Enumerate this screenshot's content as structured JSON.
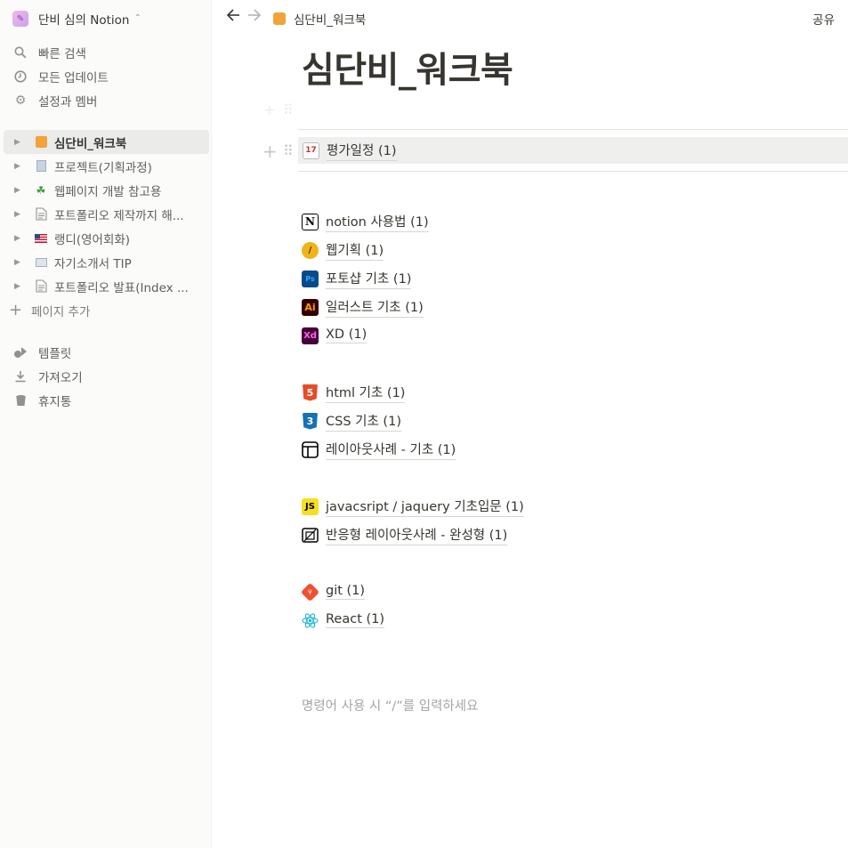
{
  "workspace": {
    "name": "단비 심의 Notion"
  },
  "sidebar": {
    "menu": [
      {
        "label": "빠른 검색",
        "icon": "search-icon"
      },
      {
        "label": "모든 업데이트",
        "icon": "clock-icon"
      },
      {
        "label": "설정과 멤버",
        "icon": "gear-icon"
      }
    ],
    "pages": [
      {
        "label": "심단비_워크북",
        "icon": "book-icon",
        "active": true
      },
      {
        "label": "프로젝트(기획과정)",
        "icon": "doc-icon"
      },
      {
        "label": "웹페이지 개발 참고용",
        "icon": "shamrock-icon"
      },
      {
        "label": "포트폴리오 제작까지 해...",
        "icon": "page-icon"
      },
      {
        "label": "랭디(영어회화)",
        "icon": "us-flag-icon"
      },
      {
        "label": "자기소개서 TIP",
        "icon": "computer-icon"
      },
      {
        "label": "포트폴리오 발표(Index ...",
        "icon": "page-icon"
      }
    ],
    "add_page": "페이지 추가",
    "bottom": [
      {
        "label": "템플릿",
        "icon": "shapes-icon"
      },
      {
        "label": "가져오기",
        "icon": "download-icon"
      },
      {
        "label": "휴지통",
        "icon": "trash-icon"
      }
    ]
  },
  "topbar": {
    "breadcrumb": "심단비_워크북",
    "share": "공유"
  },
  "page": {
    "title": "심단비_워크북",
    "eval_link": "평가일정 (1)",
    "group1": [
      {
        "label": "notion 사용법 (1)",
        "icon": "notion-icon"
      },
      {
        "label": "웹기획 (1)",
        "icon": "pencil-icon"
      },
      {
        "label": "포토샵 기초 (1)",
        "icon": "photoshop-icon"
      },
      {
        "label": "일러스트 기초 (1)",
        "icon": "illustrator-icon"
      },
      {
        "label": "XD (1)",
        "icon": "xd-icon"
      }
    ],
    "group2": [
      {
        "label": "html 기초 (1)",
        "icon": "html5-icon"
      },
      {
        "label": "CSS 기초 (1)",
        "icon": "css3-icon"
      },
      {
        "label": "레이아웃사례 - 기초 (1)",
        "icon": "layout-icon"
      }
    ],
    "group3": [
      {
        "label": "javacsript / jaquery 기초입문 (1)",
        "icon": "js-icon"
      },
      {
        "label": "반응형 레이아웃사례 - 완성형 (1)",
        "icon": "responsive-icon"
      }
    ],
    "group4": [
      {
        "label": "git (1)",
        "icon": "git-icon"
      },
      {
        "label": "React (1)",
        "icon": "react-icon"
      }
    ],
    "placeholder": "명령어 사용 시 “/”를 입력하세요"
  }
}
